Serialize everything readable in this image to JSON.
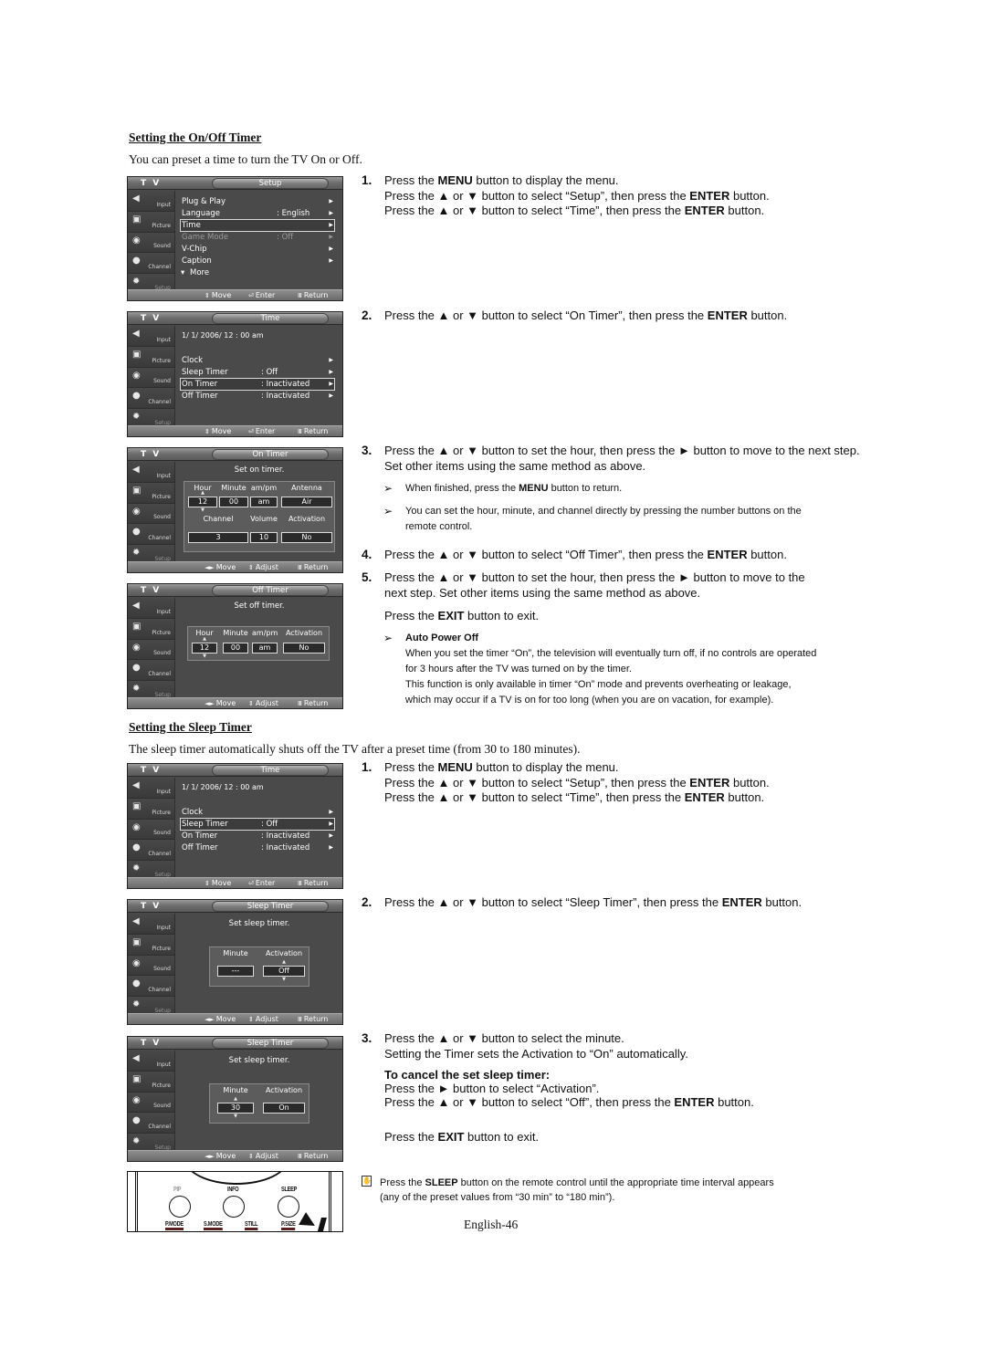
{
  "sections": {
    "onoff": {
      "title": "Setting the On/Off Timer",
      "intro": "You can preset a time to turn the TV On or Off."
    },
    "sleep": {
      "title": "Setting the Sleep Timer",
      "intro": "The sleep timer automatically shuts off the TV after a preset time (from 30 to 180 minutes)."
    }
  },
  "osd_common": {
    "tv_label": "T V",
    "sidebar": [
      "Input",
      "Picture",
      "Sound",
      "Channel",
      "Setup"
    ],
    "footer_enter": {
      "move": "Move",
      "enter": "Enter",
      "return": "Return"
    },
    "footer_adjust": {
      "move": "Move",
      "adjust": "Adjust",
      "return": "Return"
    }
  },
  "screens": {
    "setup": {
      "title": "Setup",
      "rows": [
        {
          "label": "Plug & Play",
          "value": ""
        },
        {
          "label": "Language",
          "value": ": English"
        },
        {
          "label": "Time",
          "value": ""
        },
        {
          "label": "Game Mode",
          "value": ": Off"
        },
        {
          "label": "V-Chip",
          "value": ""
        },
        {
          "label": "Caption",
          "value": ""
        },
        {
          "label": "More",
          "value": ""
        }
      ]
    },
    "time1": {
      "title": "Time",
      "datetime": "1/ 1/ 2006/ 12 : 00  am",
      "rows": [
        {
          "label": "Clock",
          "value": ""
        },
        {
          "label": "Sleep Timer",
          "value": ": Off"
        },
        {
          "label": "On Timer",
          "value": ": Inactivated"
        },
        {
          "label": "Off Timer",
          "value": ": Inactivated"
        }
      ]
    },
    "on_timer": {
      "title": "On Timer",
      "subtitle": "Set on timer.",
      "headers1": [
        "Hour",
        "Minute",
        "am/pm",
        "Antenna"
      ],
      "values1": [
        "12",
        "00",
        "am",
        "Air"
      ],
      "headers2": [
        "Channel",
        "Volume",
        "Activation"
      ],
      "values2": [
        "3",
        "10",
        "No"
      ]
    },
    "off_timer": {
      "title": "Off Timer",
      "subtitle": "Set off timer.",
      "headers": [
        "Hour",
        "Minute",
        "am/pm",
        "Activation"
      ],
      "values": [
        "12",
        "00",
        "am",
        "No"
      ]
    },
    "time2": {
      "title": "Time",
      "datetime": "1/ 1/ 2006/ 12 : 00  am",
      "rows": [
        {
          "label": "Clock",
          "value": ""
        },
        {
          "label": "Sleep Timer",
          "value": ": Off"
        },
        {
          "label": "On Timer",
          "value": ": Inactivated"
        },
        {
          "label": "Off Timer",
          "value": ": Inactivated"
        }
      ]
    },
    "sleep1": {
      "title": "Sleep Timer",
      "subtitle": "Set sleep timer.",
      "headers": [
        "Minute",
        "Activation"
      ],
      "values": [
        "---",
        "Off"
      ]
    },
    "sleep2": {
      "title": "Sleep Timer",
      "subtitle": "Set sleep timer.",
      "headers": [
        "Minute",
        "Activation"
      ],
      "values": [
        "30",
        "On"
      ]
    }
  },
  "remote": {
    "top_labels": [
      "PIP",
      "INFO",
      "SLEEP"
    ],
    "bottom_labels": [
      "P.MODE",
      "S.MODE",
      "STILL",
      "P.SIZE"
    ]
  },
  "steps_onoff": [
    {
      "num": "1.",
      "lines": [
        "Press the <b>MENU</b> button to display the menu.",
        "Press the ▲ or ▼ button to select “Setup”, then press the <b>ENTER</b> button.",
        "Press the ▲ or ▼ button to select “Time”, then press the <b>ENTER</b> button."
      ]
    },
    {
      "num": "2.",
      "lines": [
        "Press the ▲ or ▼ button to select “On Timer”, then press the <b>ENTER</b> button."
      ]
    },
    {
      "num": "3.",
      "lines": [
        "Press the ▲ or ▼ button to set the hour, then press the ► button to move to the next step.",
        "Set other items using the same method as above."
      ]
    },
    {
      "num": "4.",
      "lines": [
        "Press the ▲ or ▼ button to select “Off Timer”, then press the <b>ENTER</b> button."
      ]
    },
    {
      "num": "5.",
      "lines": [
        "Press the ▲ or ▼ button to set the hour, then press the ► button to move to the",
        "next step. Set other items using the same method as above."
      ]
    }
  ],
  "notes_step3": [
    "When finished, press the <b>MENU</b> button to return.",
    "You can set the hour, minute, and channel directly by pressing the number buttons on the<br>remote control."
  ],
  "exit_line": "Press the <b>EXIT</b> button to exit.",
  "auto_power_off": {
    "title": "Auto Power Off",
    "text": "When you set the timer “On”, the television will eventually turn off, if no controls are operated<br>for 3 hours after the TV was turned on by the timer.<br>This function is only available in timer “On” mode and prevents overheating or leakage,<br>which may occur if a TV is on for too long (when you are on vacation, for example)."
  },
  "steps_sleep": [
    {
      "num": "1.",
      "lines": [
        "Press the <b>MENU</b> button to display the menu.",
        "Press the ▲ or ▼ button to select “Setup”, then press the <b>ENTER</b> button.",
        "Press the ▲ or ▼ button to select “Time”, then press the <b>ENTER</b> button."
      ]
    },
    {
      "num": "2.",
      "lines": [
        "Press the ▲ or ▼ button to select “Sleep Timer”, then press the <b>ENTER</b> button."
      ]
    },
    {
      "num": "3.",
      "lines": [
        "Press the ▲ or ▼ button to select the minute.",
        "Setting the Timer sets the Activation to “On” automatically."
      ]
    }
  ],
  "cancel": {
    "title": "To cancel the set sleep timer:",
    "lines": [
      "Press the ► button to select “Activation”.",
      "Press the ▲ or ▼ button to select “Off”, then press the <b>ENTER</b> button."
    ]
  },
  "sleep_note": "Press the <b>SLEEP</b> button on the remote control until the appropriate time interval appears<br>(any of the preset values from “30 min” to “180 min”).",
  "page_number": "English-46"
}
